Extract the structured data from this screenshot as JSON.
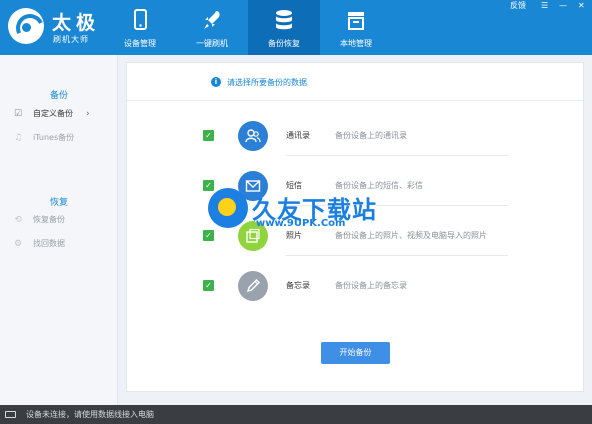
{
  "app": {
    "title": "太极",
    "subtitle": "刷机大师"
  },
  "nav": {
    "tabs": [
      {
        "label": "设备管理",
        "icon": "phone-icon"
      },
      {
        "label": "一键刷机",
        "icon": "rocket-icon"
      },
      {
        "label": "备份恢复",
        "icon": "database-icon",
        "active": true
      },
      {
        "label": "本地管理",
        "icon": "store-icon"
      }
    ]
  },
  "window": {
    "feedback": "反馈",
    "menu": "☰",
    "minimize": "—",
    "close": "✕"
  },
  "sidebar": {
    "backup_head": "备份",
    "backup_items": [
      {
        "label": "自定义备份",
        "icon": "checklist-icon",
        "active": true
      },
      {
        "label": "iTunes备份",
        "icon": "music-icon"
      }
    ],
    "restore_head": "恢复",
    "restore_items": [
      {
        "label": "恢复备份",
        "icon": "restore-icon"
      },
      {
        "label": "找回数据",
        "icon": "gear-icon"
      }
    ]
  },
  "main": {
    "hint": "请选择所要备份的数据",
    "rows": [
      {
        "name": "通讯录",
        "desc": "备份设备上的通讯录",
        "checked": true,
        "color": "#2b7fd6",
        "icon": "contacts-icon"
      },
      {
        "name": "短信",
        "desc": "备份设备上的短信、彩信",
        "checked": true,
        "color": "#2b7fd6",
        "icon": "message-icon"
      },
      {
        "name": "照片",
        "desc": "备份设备上的照片、视频及电脑导入的照片",
        "checked": true,
        "color": "#8fd43c",
        "icon": "photo-icon"
      },
      {
        "name": "备忘录",
        "desc": "备份设备上的备忘录",
        "checked": true,
        "color": "#9aa3ad",
        "icon": "memo-icon"
      }
    ],
    "start_button": "开始备份"
  },
  "watermark": {
    "text": "久友下载站",
    "url": "www.9UPK.Com"
  },
  "status": {
    "text": "设备未连接，请使用数据线接入电脑"
  }
}
